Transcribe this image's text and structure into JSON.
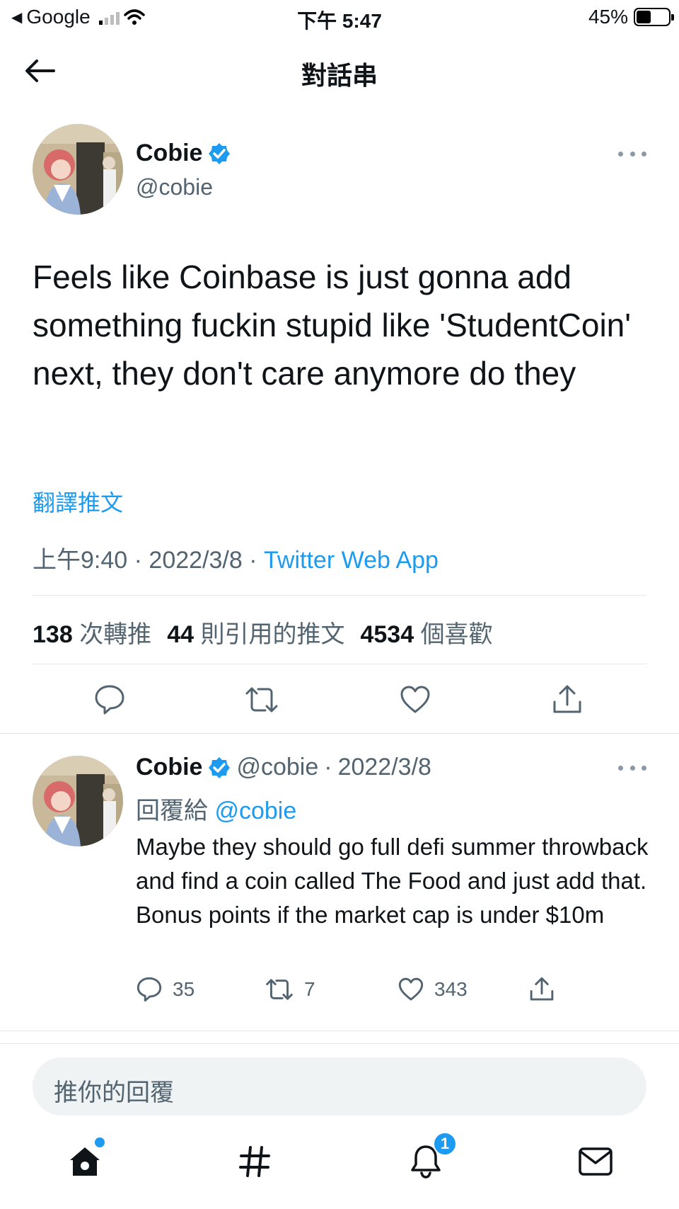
{
  "status_bar": {
    "carrier": "Google",
    "time": "下午 5:47",
    "battery": "45%",
    "battery_level": 0.45
  },
  "header": {
    "title": "對話串"
  },
  "main_tweet": {
    "name": "Cobie",
    "handle": "@cobie",
    "text": "Feels like Coinbase is just gonna add something fuckin stupid like 'StudentCoin' next, they don't care anymore do they",
    "translate_label": "翻譯推文",
    "time": "上午9:40",
    "date": "2022/3/8",
    "source": "Twitter Web App",
    "retweets_count": "138",
    "retweets_label": "次轉推",
    "quotes_count": "44",
    "quotes_label": "則引用的推文",
    "likes_count": "4534",
    "likes_label": "個喜歡"
  },
  "reply_tweet": {
    "name": "Cobie",
    "handle": "@cobie",
    "date": "2022/3/8",
    "replying_prefix": "回覆給",
    "replying_to": "@cobie",
    "text": "Maybe they should go full defi summer throwback and find a coin called The Food and just add that. Bonus points if the market cap is under $10m",
    "reply_count": "35",
    "retweet_count": "7",
    "like_count": "343"
  },
  "composer": {
    "placeholder": "推你的回覆"
  },
  "tabbar": {
    "notifications_badge": "1"
  },
  "colors": {
    "accent": "#1d9bf0",
    "text": "#0f1419",
    "muted": "#536471"
  },
  "icons": [
    "back-arrow-icon",
    "verified-badge-icon",
    "more-icon",
    "reply-icon",
    "retweet-icon",
    "like-icon",
    "share-icon",
    "home-icon",
    "explore-hash-icon",
    "bell-icon",
    "mail-icon"
  ]
}
